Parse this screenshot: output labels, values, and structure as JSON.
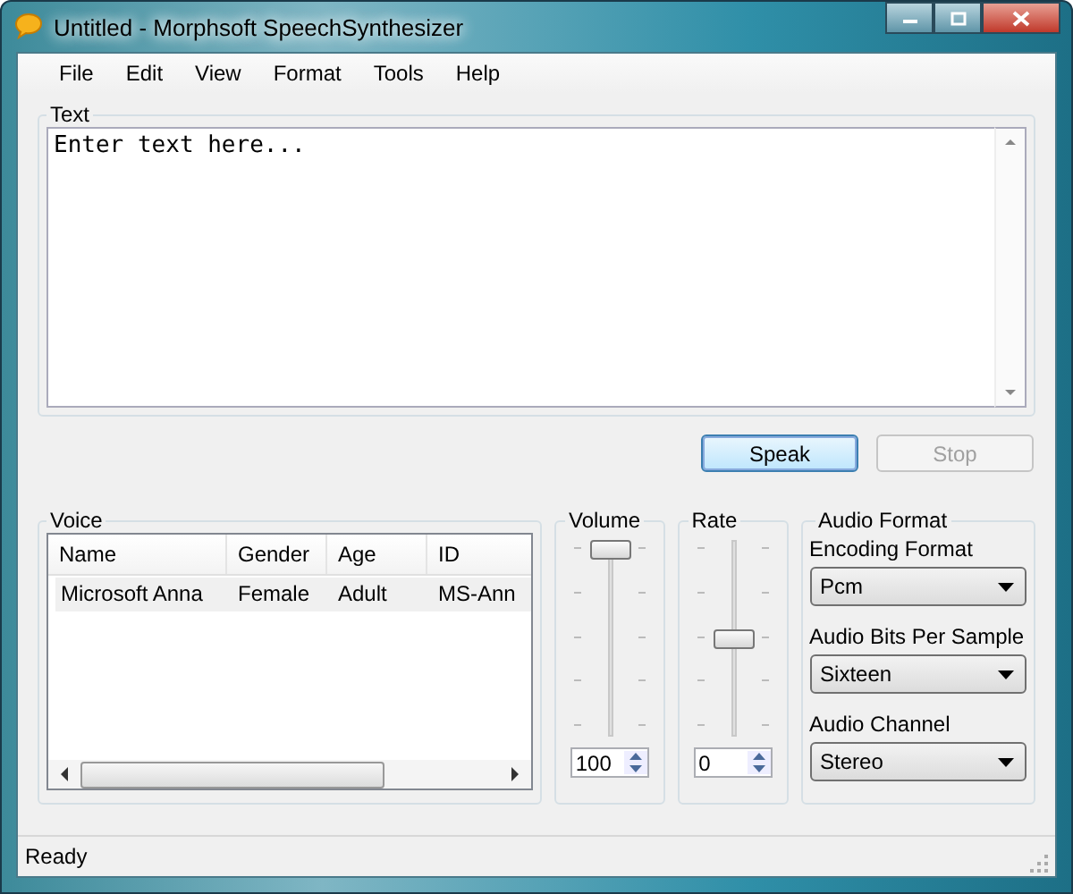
{
  "window": {
    "title": "Untitled - Morphsoft SpeechSynthesizer"
  },
  "menu": [
    "File",
    "Edit",
    "View",
    "Format",
    "Tools",
    "Help"
  ],
  "text_group": {
    "label": "Text",
    "placeholder": "Enter text here..."
  },
  "buttons": [
    {
      "label": "Speak",
      "disabled": false
    },
    {
      "label": "Stop",
      "disabled": true
    }
  ],
  "voice": {
    "label": "Voice",
    "columns": [
      "Name",
      "Gender",
      "Age",
      "ID"
    ],
    "rows": [
      {
        "cells": [
          "Microsoft Anna",
          "Female",
          "Adult",
          "MS-Ann"
        ],
        "selected": true
      }
    ]
  },
  "sliders": [
    {
      "label": "Volume",
      "level": 1,
      "value": "100"
    },
    {
      "label": "Rate",
      "level": 0.5,
      "value": "0"
    }
  ],
  "audio_format": {
    "label": "Audio Format",
    "fields": [
      {
        "label": "Encoding Format",
        "value": "Pcm"
      },
      {
        "label": "Audio Bits Per Sample",
        "value": "Sixteen"
      },
      {
        "label": "Audio Channel",
        "value": "Stereo"
      }
    ]
  },
  "status_bar": "Ready"
}
